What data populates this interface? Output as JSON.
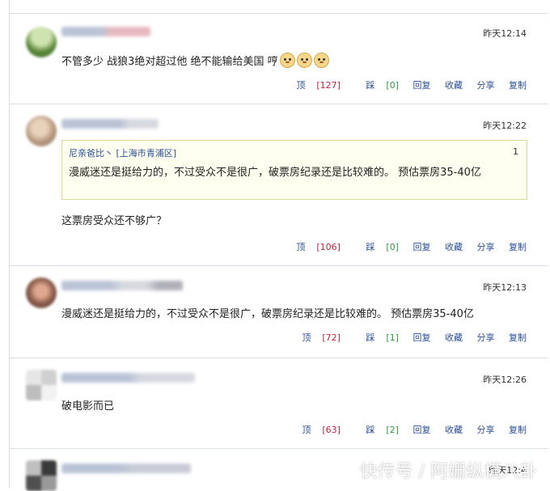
{
  "comments": [
    {
      "time": "昨天12:14",
      "text": "不管多少 战狼3绝对超过他 绝不能输给美国 哼",
      "emoji": [
        "smile-emoji",
        "smile-emoji",
        "smile-emoji"
      ],
      "up_label": "顶",
      "up_count": "[127]",
      "down_label": "踩",
      "down_count": "[0]",
      "reply": "回复",
      "favorite": "收藏",
      "share": "分享",
      "copy": "复制"
    },
    {
      "time": "昨天12:22",
      "quote": {
        "user": "尼亲爸比丶",
        "location": "[上海市青浦区]",
        "floor": "1",
        "text": "漫威迷还是挺给力的，不过受众不是很广，破票房纪录还是比较难的。 预估票房35-40亿"
      },
      "text": "这票房受众还不够广？",
      "up_label": "顶",
      "up_count": "[106]",
      "down_label": "踩",
      "down_count": "[0]",
      "reply": "回复",
      "favorite": "收藏",
      "share": "分享",
      "copy": "复制"
    },
    {
      "time": "昨天12:13",
      "text": "漫威迷还是挺给力的，不过受众不是很广，破票房纪录还是比较难的。 预估票房35-40亿",
      "up_label": "顶",
      "up_count": "[72]",
      "down_label": "踩",
      "down_count": "[1]",
      "reply": "回复",
      "favorite": "收藏",
      "share": "分享",
      "copy": "复制"
    },
    {
      "time": "昨天12:26",
      "text": "破电影而已",
      "up_label": "顶",
      "up_count": "[63]",
      "down_label": "踩",
      "down_count": "[2]",
      "reply": "回复",
      "favorite": "收藏",
      "share": "分享",
      "copy": "复制"
    },
    {
      "time": "昨天12:4"
    }
  ],
  "watermark": "快传号 / 阿姗纵横八卦",
  "colors": {
    "link": "#2a4f96",
    "up_count": "#c4233b",
    "down_count": "#2a9d3b",
    "quote_bg": "#fffff0",
    "quote_border": "#e0d89a",
    "divider": "#d9dde4"
  }
}
